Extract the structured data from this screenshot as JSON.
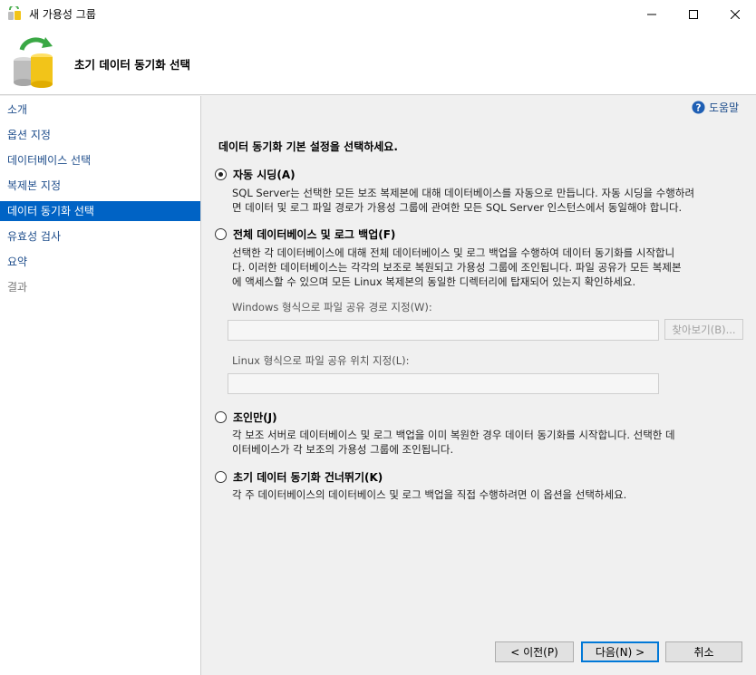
{
  "window": {
    "title": "새 가용성 그룹",
    "icon": "availability-group-icon"
  },
  "header": {
    "title": "초기 데이터 동기화 선택",
    "icon": "database-sync-icon"
  },
  "nav": {
    "items": [
      {
        "label": "소개",
        "state": "normal"
      },
      {
        "label": "옵션 지정",
        "state": "normal"
      },
      {
        "label": "데이터베이스 선택",
        "state": "normal"
      },
      {
        "label": "복제본 지정",
        "state": "normal"
      },
      {
        "label": "데이터 동기화 선택",
        "state": "active"
      },
      {
        "label": "유효성 검사",
        "state": "normal"
      },
      {
        "label": "요약",
        "state": "normal"
      },
      {
        "label": "결과",
        "state": "disabled"
      }
    ]
  },
  "help": {
    "label": "도움말"
  },
  "main": {
    "instruction": "데이터 동기화 기본 설정을 선택하세요.",
    "options": [
      {
        "label": "자동 시딩(A)",
        "checked": true,
        "description": [
          "SQL Server는 선택한 모든 보조 복제본에 대해 데이터베이스를 자동으로 만듭니다. 자동 시딩을 수행하려",
          "면 데이터 및 로그 파일 경로가 가용성 그룹에 관여한 모든 SQL Server 인스턴스에서 동일해야 합니다."
        ]
      },
      {
        "label": "전체 데이터베이스 및 로그 백업(F)",
        "checked": false,
        "description": [
          "선택한 각 데이터베이스에 대해 전체 데이터베이스 및 로그 백업을 수행하여 데이터 동기화를 시작합니",
          "다. 이러한 데이터베이스는 각각의 보조로 복원되고 가용성 그룹에 조인됩니다. 파일 공유가 모든 복제본",
          "에 액세스할 수 있으며 모든 Linux 복제본의 동일한 디렉터리에 탑재되어 있는지 확인하세요."
        ]
      },
      {
        "label": "조인만(J)",
        "checked": false,
        "description": [
          "각 보조 서버로 데이터베이스 및 로그 백업을 이미 복원한 경우 데이터 동기화를 시작합니다. 선택한 데",
          "이터베이스가 각 보조의 가용성 그룹에 조인됩니다."
        ]
      },
      {
        "label": "초기 데이터 동기화 건너뛰기(K)",
        "checked": false,
        "description": [
          "각 주 데이터베이스의 데이터베이스 및 로그 백업을 직접 수행하려면 이 옵션을 선택하세요."
        ]
      }
    ],
    "windows_share": {
      "label": "Windows 형식으로 파일 공유 경로 지정(W):",
      "value": ""
    },
    "browse_label": "찾아보기(B)...",
    "linux_share": {
      "label": "Linux 형식으로 파일 공유 위치 지정(L):",
      "value": ""
    }
  },
  "footer": {
    "prev_label": "< 이전(P)",
    "next_label": "다음(N) >",
    "cancel_label": "취소"
  },
  "colors": {
    "accent": "#0063c5",
    "link": "#1f4e8c"
  }
}
